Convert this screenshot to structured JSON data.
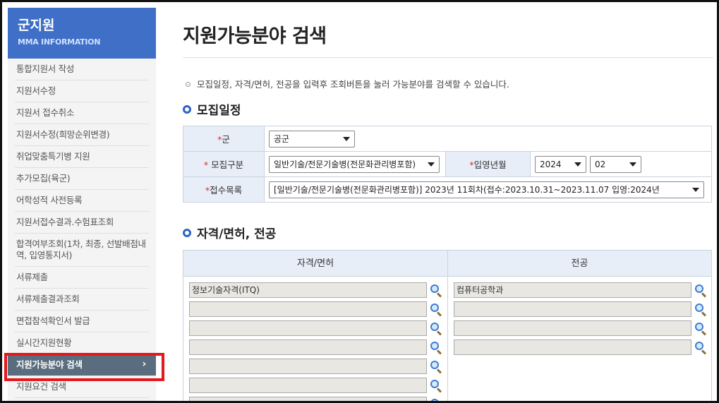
{
  "sidebar": {
    "title": "군지원",
    "subtitle": "MMA INFORMATION",
    "items": [
      {
        "label": "통합지원서 작성"
      },
      {
        "label": "지원서수정"
      },
      {
        "label": "지원서 접수취소"
      },
      {
        "label": "지원서수정(희망순위변경)"
      },
      {
        "label": "취업맞춤특기병 지원"
      },
      {
        "label": "추가모집(육군)"
      },
      {
        "label": "어학성적 사전등록"
      },
      {
        "label": "지원서접수결과.수험표조회"
      },
      {
        "label": "합격여부조회(1차, 최종, 선발배점내역, 입영통지서)"
      },
      {
        "label": "서류제출"
      },
      {
        "label": "서류제출결과조회"
      },
      {
        "label": "면접참석확인서 발급"
      },
      {
        "label": "실시간지원현황"
      },
      {
        "label": "지원가능분야 검색",
        "active": true
      },
      {
        "label": "지원요건 검색"
      }
    ],
    "active_chevron": "›"
  },
  "main": {
    "title": "지원가능분야 검색",
    "notice": "모집일정, 자격/면허, 전공을 입력후 조회버튼을 눌러 가능분야를 검색할 수 있습니다.",
    "schedule": {
      "title": "모집일정",
      "req_mark": "*",
      "branch_label": "군",
      "branch_value": "공군",
      "type_label": " 모집구분",
      "type_value": "일반기술/전문기술병(전문화관리병포함)",
      "enlist_label": "입영년월",
      "year_value": "2024",
      "month_value": "02",
      "list_label": "접수목록",
      "list_value": "[일반기술/전문기술병(전문화관리병포함)] 2023년 11회차(접수:2023.10.31~2023.11.07 입영:2024년"
    },
    "qualification": {
      "title": "자격/면허, 전공",
      "license_header": "자격/면허",
      "major_header": "전공",
      "licenses": [
        "정보기술자격(ITQ)",
        "",
        "",
        "",
        "",
        "",
        ""
      ],
      "majors": [
        "컴퓨터공학과",
        "",
        "",
        ""
      ]
    }
  },
  "colors": {
    "brand_blue": "#3f6fc6",
    "active_item": "#5a6d7f",
    "highlight_red": "#e3191d",
    "required_red": "#e12a2a",
    "section_dot": "#2d63c8"
  }
}
